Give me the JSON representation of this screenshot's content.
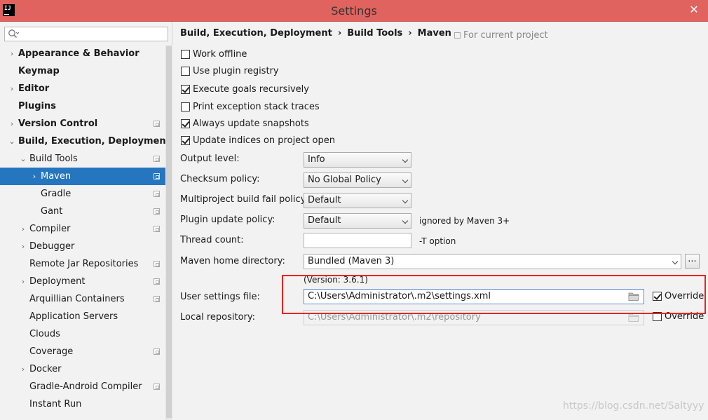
{
  "window": {
    "title": "Settings",
    "app_icon_text": "IJ",
    "close_symbol": "✕"
  },
  "sidebar": {
    "search_placeholder": "",
    "items": [
      {
        "label": "Appearance & Behavior"
      },
      {
        "label": "Keymap"
      },
      {
        "label": "Editor"
      },
      {
        "label": "Plugins"
      },
      {
        "label": "Version Control"
      },
      {
        "label": "Build, Execution, Deployment"
      },
      {
        "label": "Build Tools"
      },
      {
        "label": "Maven"
      },
      {
        "label": "Gradle"
      },
      {
        "label": "Gant"
      },
      {
        "label": "Compiler"
      },
      {
        "label": "Debugger"
      },
      {
        "label": "Remote Jar Repositories"
      },
      {
        "label": "Deployment"
      },
      {
        "label": "Arquillian Containers"
      },
      {
        "label": "Application Servers"
      },
      {
        "label": "Clouds"
      },
      {
        "label": "Coverage"
      },
      {
        "label": "Docker"
      },
      {
        "label": "Gradle-Android Compiler"
      },
      {
        "label": "Instant Run"
      }
    ]
  },
  "breadcrumb": {
    "part1": "Build, Execution, Deployment",
    "part2": "Build Tools",
    "part3": "Maven",
    "separator": "›",
    "scope": "For current project"
  },
  "options": {
    "work_offline": "Work offline",
    "use_plugin_registry": "Use plugin registry",
    "execute_goals_recursively": "Execute goals recursively",
    "print_exception_stack_traces": "Print exception stack traces",
    "always_update_snapshots": "Always update snapshots",
    "update_indices": "Update indices on project open"
  },
  "form": {
    "output_level_label": "Output level:",
    "output_level_value": "Info",
    "checksum_policy_label": "Checksum policy:",
    "checksum_policy_value": "No Global Policy",
    "multiproject_label": "Multiproject build fail policy:",
    "multiproject_value": "Default",
    "plugin_update_label": "Plugin update policy:",
    "plugin_update_value": "Default",
    "plugin_update_hint": "ignored by Maven 3+",
    "thread_count_label": "Thread count:",
    "thread_count_value": "",
    "thread_count_hint": "-T option",
    "maven_home_label": "Maven home directory:",
    "maven_home_value": "Bundled (Maven 3)",
    "browse_label": "...",
    "version_text": "(Version: 3.6.1)",
    "user_settings_label": "User settings file:",
    "user_settings_value": "C:\\Users\\Administrator\\.m2\\settings.xml",
    "override_label": "Override",
    "local_repo_label": "Local repository:",
    "local_repo_value": "C:\\Users\\Administrator\\.m2\\repository",
    "override2_label": "Override"
  },
  "watermark": "https://blog.csdn.net/Saltyyy",
  "colors": {
    "titlebar": "#e0635f",
    "selection": "#2675bf",
    "highlight_box": "#e5261f"
  }
}
